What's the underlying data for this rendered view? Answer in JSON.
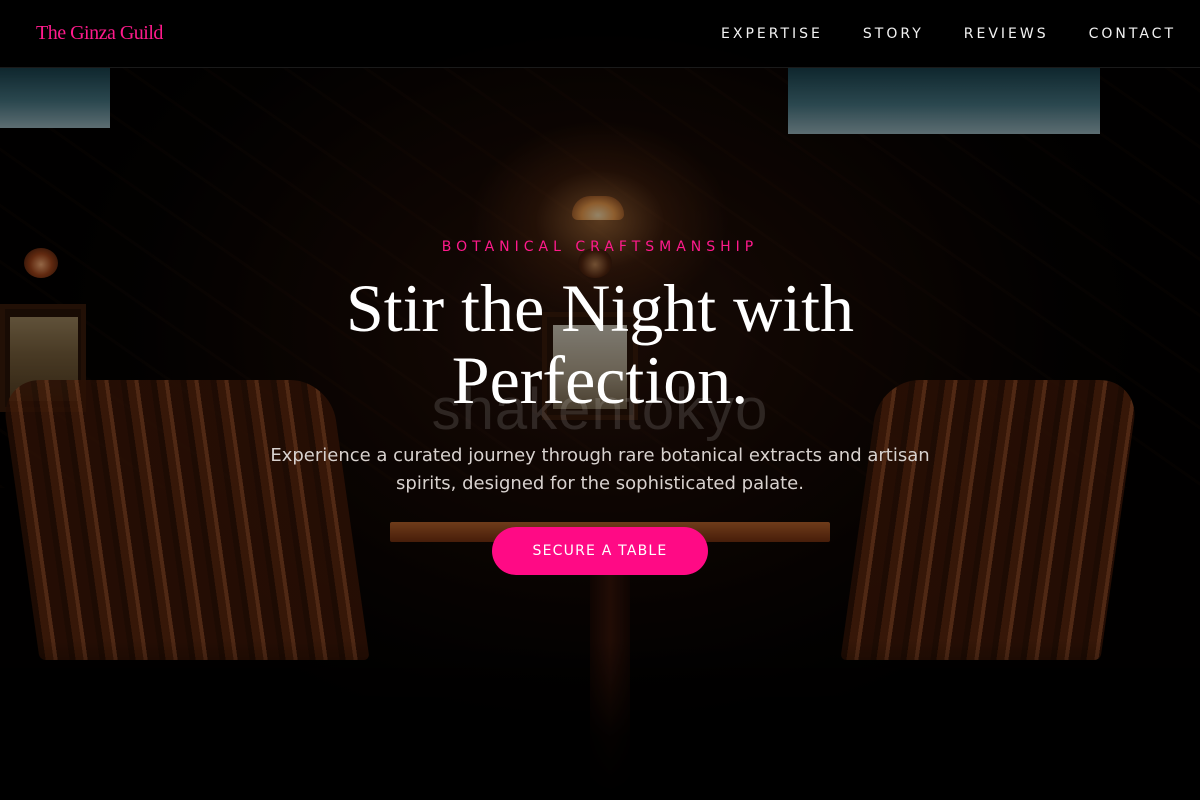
{
  "brand": {
    "name": "The Ginza Guild"
  },
  "nav": {
    "items": [
      {
        "label": "EXPERTISE"
      },
      {
        "label": "STORY"
      },
      {
        "label": "REVIEWS"
      },
      {
        "label": "CONTACT"
      }
    ]
  },
  "hero": {
    "eyebrow": "BOTANICAL CRAFTSMANSHIP",
    "headline": "Stir the Night with Perfection.",
    "subheading": "Experience a curated journey through rare botanical extracts and artisan spirits, designed for the sophisticated palate.",
    "cta_label": "SECURE A TABLE",
    "background_watermark": "shakentokyo"
  },
  "colors": {
    "accent": "#ff0a85",
    "background": "#000000",
    "text": "#ffffff"
  }
}
